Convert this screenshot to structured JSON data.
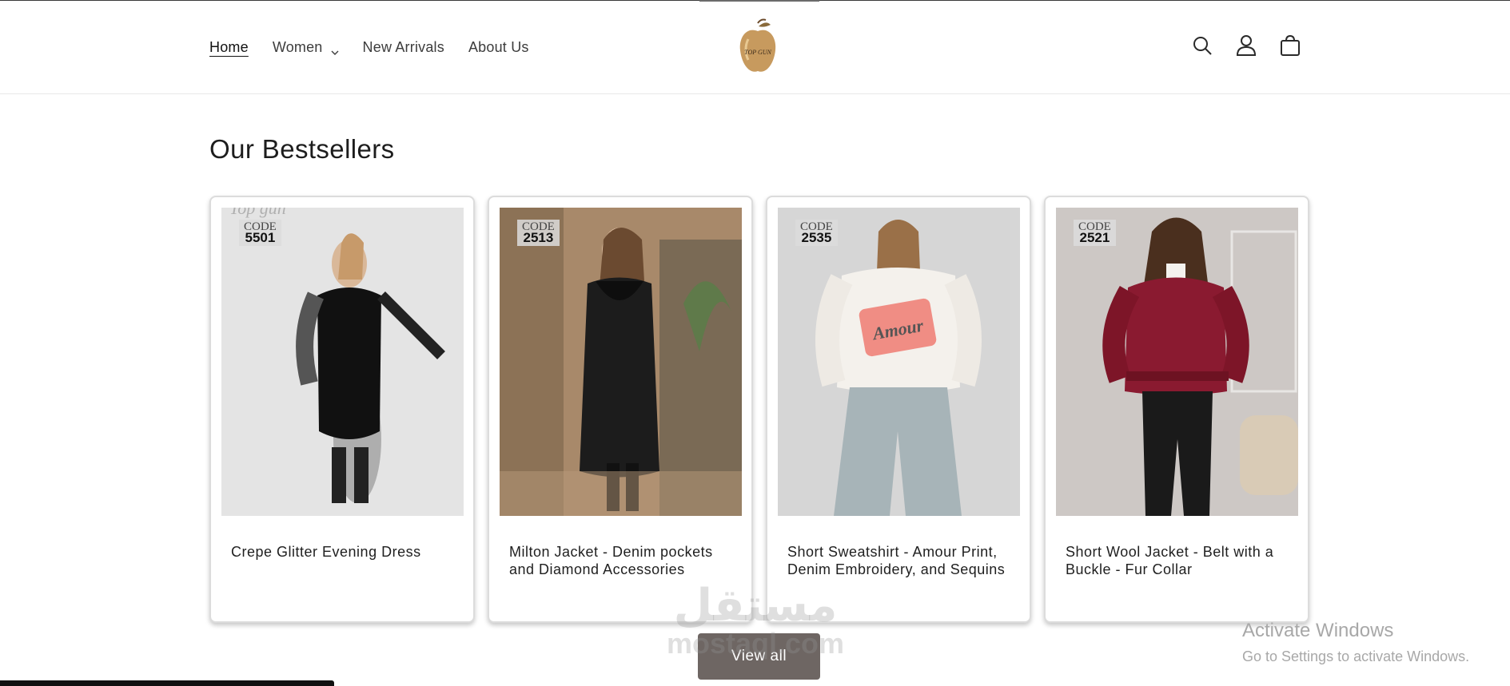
{
  "header": {
    "nav": [
      {
        "label": "Home",
        "active": true
      },
      {
        "label": "Women",
        "dropdown": true
      },
      {
        "label": "New Arrivals"
      },
      {
        "label": "About Us"
      }
    ],
    "logo_text": "TOP GUN",
    "icons": [
      "search-icon",
      "account-icon",
      "cart-icon"
    ]
  },
  "section": {
    "title": "Our Bestsellers",
    "view_all_label": "View all"
  },
  "products": [
    {
      "title": "Crepe Glitter Evening Dress",
      "code_label": "CODE",
      "code": "5501",
      "image_label": "Top gun"
    },
    {
      "title": "Milton Jacket - Denim pockets and Diamond Accessories",
      "code_label": "CODE",
      "code": "2513"
    },
    {
      "title": "Short Sweatshirt - Amour Print, Denim Embroidery, and Sequins",
      "code_label": "CODE",
      "code": "2535",
      "print_text": "Amour"
    },
    {
      "title": "Short Wool Jacket - Belt with a Buckle - Fur Collar",
      "code_label": "CODE",
      "code": "2521"
    }
  ],
  "overlays": {
    "watermark_ar": "مستقل",
    "watermark_latin": "mostaql.com",
    "activate_title": "Activate Windows",
    "activate_sub": "Go to Settings to activate Windows."
  },
  "colors": {
    "button_bg": "#6e6663",
    "text": "#121212",
    "card_border": "#dcdcdc"
  }
}
